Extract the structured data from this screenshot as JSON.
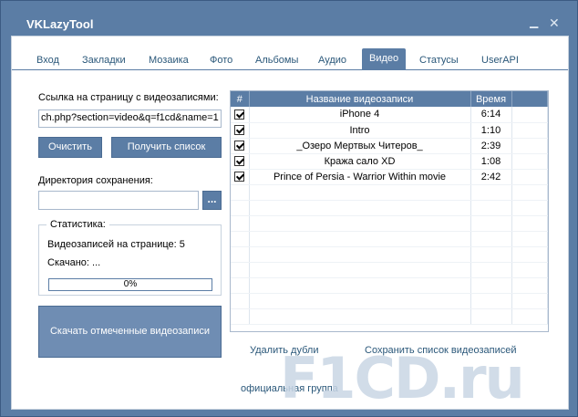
{
  "window": {
    "title": "VKLazyTool",
    "minimize_glyph": "▁",
    "close_glyph": "✕"
  },
  "tabs": [
    {
      "label": "Вход"
    },
    {
      "label": "Закладки"
    },
    {
      "label": "Мозаика"
    },
    {
      "label": "Фото"
    },
    {
      "label": "Альбомы"
    },
    {
      "label": "Аудио"
    },
    {
      "label": "Видео",
      "active": true
    },
    {
      "label": "Статусы"
    },
    {
      "label": "UserAPI"
    }
  ],
  "left": {
    "url_label": "Ссылка на страницу с видеозаписями:",
    "url_value": "ch.php?section=video&q=f1cd&name=1",
    "clear_button": "Очистить",
    "get_list_button": "Получить список",
    "dir_label": "Директория сохранения:",
    "dir_value": "",
    "browse_button": "...",
    "stats": {
      "title": "Статистика:",
      "videos_on_page": "Видеозаписей на странице: 5",
      "downloaded": "Скачано: ...",
      "progress_text": "0%",
      "progress_value": 0
    },
    "download_button": "Скачать отмеченные видеозаписи"
  },
  "table": {
    "headers": [
      "#",
      "Название видеозаписи",
      "Время"
    ],
    "rows": [
      {
        "checked": true,
        "title": "iPhone 4",
        "time": "6:14"
      },
      {
        "checked": true,
        "title": "Intro",
        "time": "1:10"
      },
      {
        "checked": true,
        "title": "_Озеро Мертвых Читеров_",
        "time": "2:39"
      },
      {
        "checked": true,
        "title": "Кража сало XD",
        "time": "1:08"
      },
      {
        "checked": true,
        "title": "Prince of Persia - Warrior Within movie",
        "time": "2:42"
      }
    ]
  },
  "links": {
    "remove_duplicates": "Удалить дубли",
    "save_list": "Сохранить список видеозаписей",
    "official_group": "официальная группа"
  },
  "watermark": "F1CD.ru",
  "colors": {
    "accent": "#5b7da5",
    "link": "#2b587a"
  }
}
